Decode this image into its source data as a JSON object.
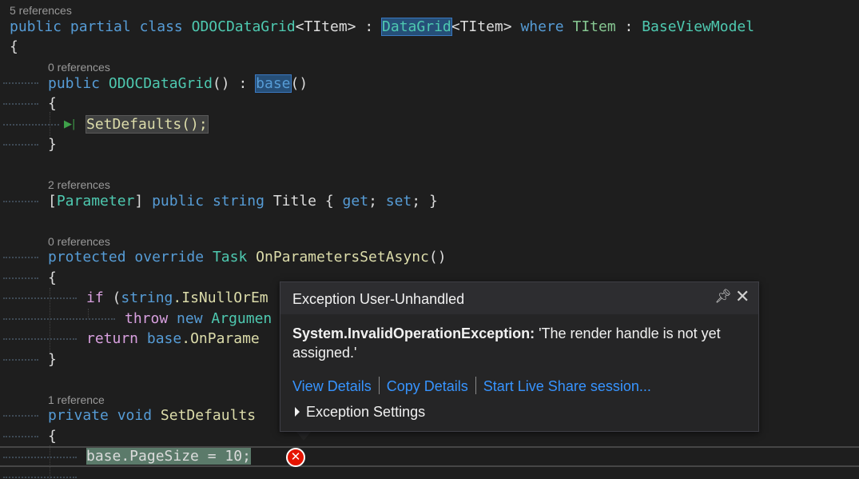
{
  "editor": {
    "refs": {
      "class_refs": "5 references",
      "ctor_refs": "0 references",
      "title_refs": "2 references",
      "onparams_refs": "0 references",
      "setdefaults_refs": "1 reference"
    },
    "tokens": {
      "public": "public",
      "partial": "partial",
      "class": "class",
      "class_name": "ODOCDataGrid",
      "titem_generic": "<TItem>",
      "colon": ":",
      "datagrid": "DataGrid",
      "where": "where",
      "titem": "TItem",
      "baseviewmodel": "BaseViewModel",
      "open_brace": "{",
      "close_brace": "}",
      "ctor_name": "ODOCDataGrid",
      "parens": "()",
      "base": "base",
      "setdefaults_call": "SetDefaults();",
      "parameter_attr_open": "[",
      "parameter_attr": "Parameter",
      "parameter_attr_close": "]",
      "string": "string",
      "title": "Title",
      "getset_open": "{",
      "get": "get",
      "semi": ";",
      "set": "set",
      "getset_close": "}",
      "protected": "protected",
      "override": "override",
      "task": "Task",
      "onparams": "OnParametersSetAsync",
      "if": "if",
      "if_open": "(",
      "string_lc": "string",
      "isnull": ".IsNullOrEm",
      "throw": "throw",
      "new": "new",
      "argument": "Argumen",
      "return": "return",
      "base_dot": "base",
      "onparame": ".OnParame",
      "private": "private",
      "void": "void",
      "setdefaults_name": "SetDefaults",
      "pagesize_line": "base.PageSize = 10;"
    }
  },
  "exception_popup": {
    "title": "Exception User-Unhandled",
    "pin_icon": "pin-icon",
    "close_icon": "close-icon",
    "exception_type": "System.InvalidOperationException:",
    "exception_message": "'The render handle is not yet assigned.'",
    "links": {
      "view_details": "View Details",
      "copy_details": "Copy Details",
      "live_share": "Start Live Share session..."
    },
    "exception_settings": "Exception Settings"
  },
  "error_glyph": "✕"
}
